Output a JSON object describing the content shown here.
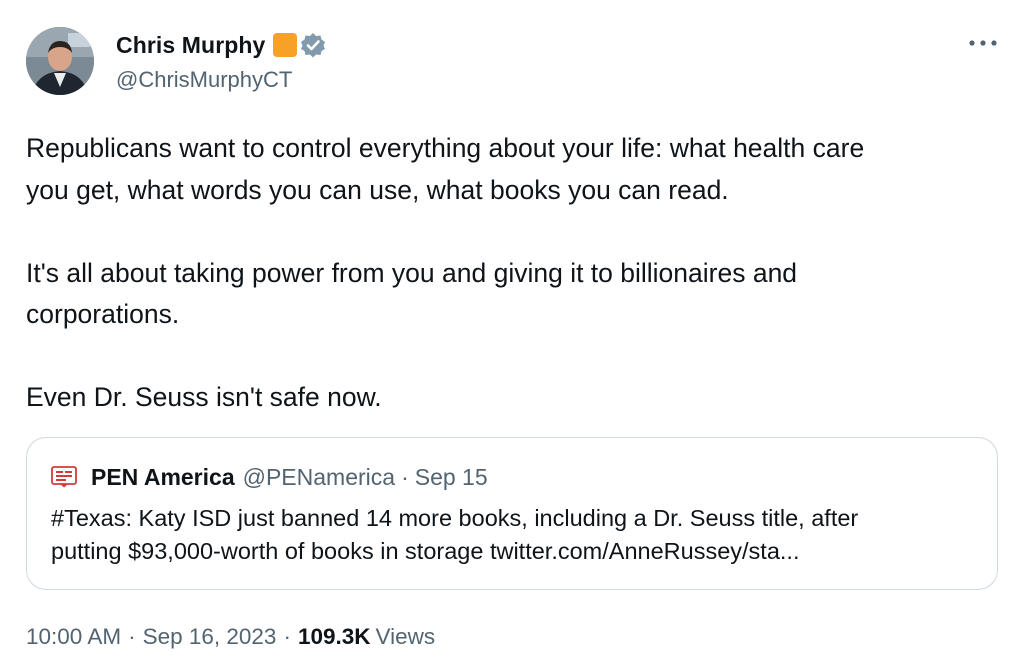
{
  "author": {
    "display_name": "Chris Murphy",
    "handle": "@ChrisMurphyCT",
    "avatar": "avatar",
    "badges": [
      "orange-square-badge",
      "verified-badge-icon"
    ],
    "verified_color": "#829aab",
    "badge_color": "#f7a128"
  },
  "more_icon": "more-horizontal-icon",
  "tweet": {
    "lines": [
      "Republicans want to control everything about your life: what health care",
      "you get, what words you can use, what books you can read.",
      "",
      "It's all about taking power from you and giving it to billionaires and",
      "corporations.",
      "",
      "Even Dr. Seuss isn't safe now."
    ]
  },
  "quote": {
    "logo_icon": "pen-america-logo",
    "name": "PEN America",
    "handle": "@PENamerica",
    "separator": "·",
    "date": "Sep 15",
    "lines": [
      "#Texas: Katy ISD just banned 14 more books, including a Dr. Seuss title, after",
      "putting $93,000-worth of books in storage twitter.com/AnneRussey/sta..."
    ]
  },
  "meta": {
    "time": "10:00 AM",
    "separator": "·",
    "date": "Sep 16, 2023",
    "views_count": "109.3K",
    "views_label": "Views"
  },
  "colors": {
    "text_primary": "#0f1419",
    "text_secondary": "#536471",
    "border": "#cfd9de"
  }
}
